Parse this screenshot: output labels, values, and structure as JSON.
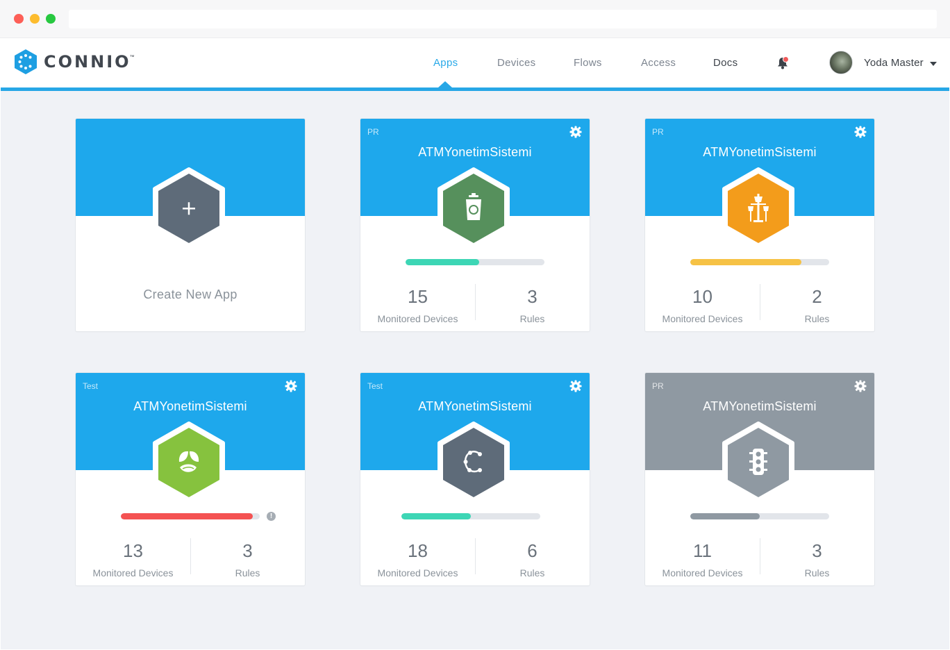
{
  "brand": {
    "name": "CONNIO",
    "tm": "™",
    "accent": "#27a7e6"
  },
  "nav": {
    "items": [
      {
        "label": "Apps",
        "active": true
      },
      {
        "label": "Devices",
        "active": false
      },
      {
        "label": "Flows",
        "active": false
      },
      {
        "label": "Access",
        "active": false
      },
      {
        "label": "Docs",
        "active": false
      }
    ],
    "notifications_icon": "bell-icon"
  },
  "user": {
    "name": "Yoda Master",
    "avatar": "avatar-photo"
  },
  "create_card": {
    "label": "Create New  App",
    "icon": "plus-icon"
  },
  "apps": [
    {
      "env": "PR",
      "title": "ATMYonetimSistemi",
      "icon": "recycle-bin-icon",
      "hex_color": "#56905c",
      "progress": 0.53,
      "bar_color": "#3dd6b5",
      "devices": "15",
      "devices_label": "Monitored Devices",
      "rules": "3",
      "rules_label": "Rules",
      "warning": false,
      "header": "blue"
    },
    {
      "env": "PR",
      "title": "ATMYonetimSistemi",
      "icon": "street-lamp-icon",
      "hex_color": "#f39c1b",
      "progress": 0.8,
      "bar_color": "#f6c245",
      "devices": "10",
      "devices_label": "Monitored Devices",
      "rules": "2",
      "rules_label": "Rules",
      "warning": false,
      "header": "blue"
    },
    {
      "env": "Test",
      "title": "ATMYonetimSistemi",
      "icon": "leaf-icon",
      "hex_color": "#86c23e",
      "progress": 0.95,
      "bar_color": "#f45252",
      "devices": "13",
      "devices_label": "Monitored Devices",
      "rules": "3",
      "rules_label": "Rules",
      "warning": true,
      "header": "blue"
    },
    {
      "env": "Test",
      "title": "ATMYonetimSistemi",
      "icon": "connio-logo-icon",
      "hex_color": "#5e6b79",
      "progress": 0.5,
      "bar_color": "#3dd6b5",
      "devices": "18",
      "devices_label": "Monitored Devices",
      "rules": "6",
      "rules_label": "Rules",
      "warning": false,
      "header": "blue"
    },
    {
      "env": "PR",
      "title": "ATMYonetimSistemi",
      "icon": "traffic-light-icon",
      "hex_color": "#8f99a2",
      "progress": 0.5,
      "bar_color": "#8f99a2",
      "devices": "11",
      "devices_label": "Monitored Devices",
      "rules": "3",
      "rules_label": "Rules",
      "warning": false,
      "header": "grey"
    }
  ],
  "colors": {
    "header_blue": "#1ea8ec",
    "header_grey": "#8f99a2",
    "create_hex": "#5e6b79"
  }
}
